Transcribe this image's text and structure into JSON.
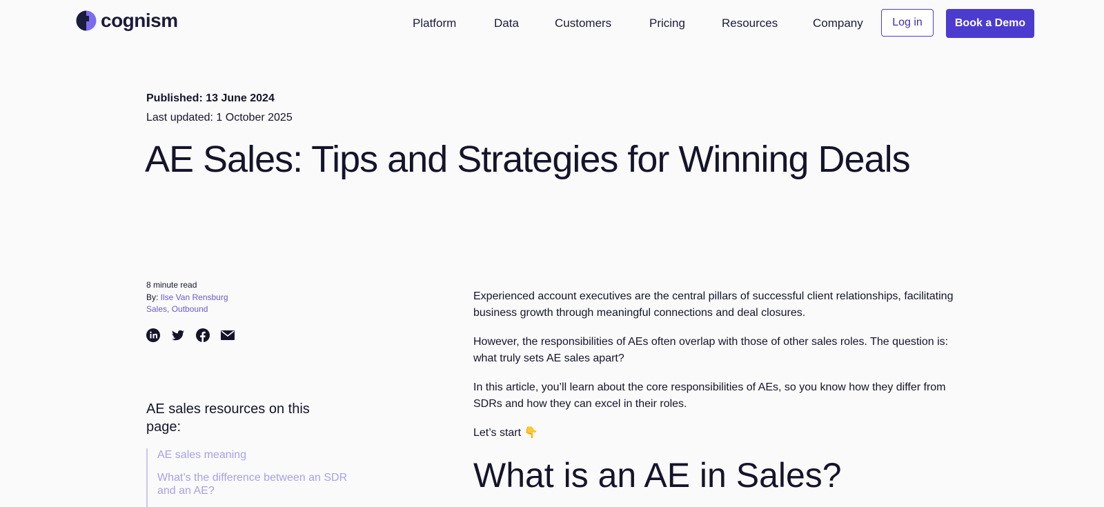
{
  "brand": {
    "name": "cognism",
    "accent": "#4c3bcf",
    "logo_color": "#7b6cf0"
  },
  "nav": {
    "items": [
      "Platform",
      "Data",
      "Customers",
      "Pricing",
      "Resources",
      "Company"
    ],
    "login_label": "Log in",
    "demo_label": "Book a Demo"
  },
  "hero": {
    "published": "Published: 13 June 2024",
    "updated": "Last updated: 1 October 2025",
    "title": "AE Sales: Tips and Strategies for Winning Deals"
  },
  "meta": {
    "read_time": "8 minute read",
    "by_prefix": "By: ",
    "author": "Ilse Van Rensburg",
    "tags": [
      "Sales",
      "Outbound"
    ]
  },
  "socials": [
    "linkedin-icon",
    "twitter-icon",
    "facebook-icon",
    "email-icon"
  ],
  "toc": {
    "heading": "AE sales resources on this page:",
    "items": [
      "AE sales meaning",
      "What’s the difference between an SDR and an AE?"
    ]
  },
  "article": {
    "paragraphs": [
      "Experienced account executives are the central pillars of successful client relationships, facilitating business growth through meaningful connections and deal closures.",
      "However, the responsibilities of AEs often overlap with those of other sales roles. The question is: what truly sets AE sales apart?",
      "In this article, you’ll learn about the core responsibilities of AEs, so you know how they differ from SDRs and how they can excel in their roles.",
      "Let’s start 👇"
    ],
    "h2": "What is an AE in Sales?"
  }
}
